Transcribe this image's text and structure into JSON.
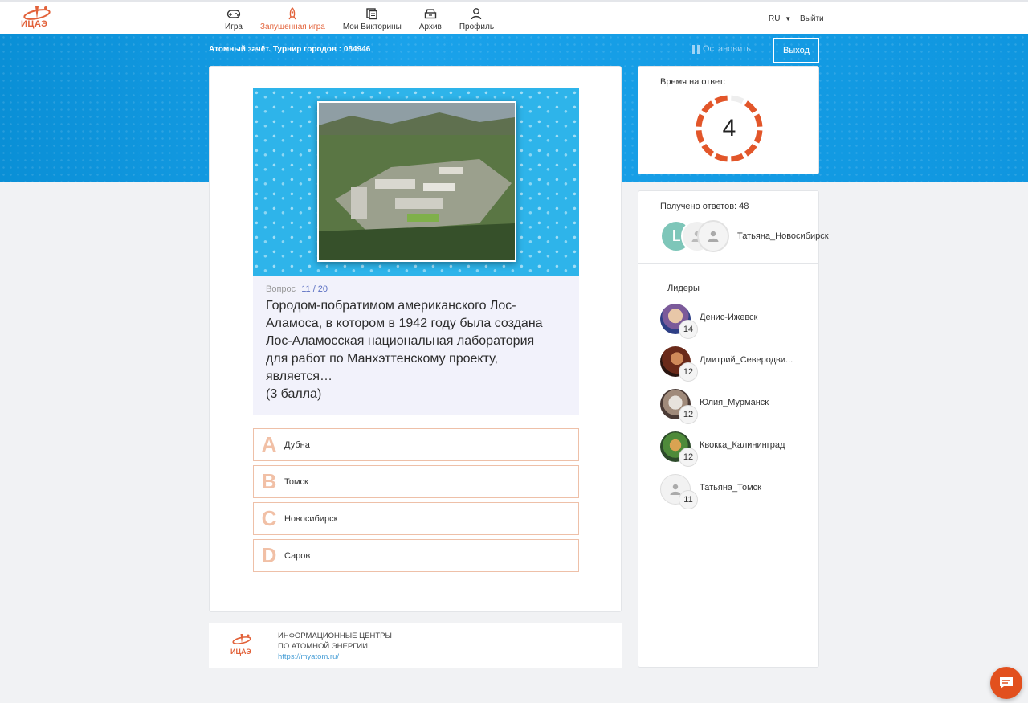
{
  "brand": {
    "logo_text": "ИЦАЭ",
    "accent": "#e2623a"
  },
  "nav": {
    "items": [
      {
        "label": "Игра",
        "icon": "gamepad-icon",
        "active": false
      },
      {
        "label": "Запущенная игра",
        "icon": "rocket-icon",
        "active": true
      },
      {
        "label": "Мои Викторины",
        "icon": "copy-icon",
        "active": false
      },
      {
        "label": "Архив",
        "icon": "archive-icon",
        "active": false
      },
      {
        "label": "Профиль",
        "icon": "user-icon",
        "active": false
      }
    ],
    "lang": "RU",
    "logout": "Выйти"
  },
  "game": {
    "title": "Атомный зачёт. Турнир городов : 084946",
    "stop_label": "Остановить",
    "exit_label": "Выход"
  },
  "question": {
    "number_label": "Вопрос",
    "number": "11 / 20",
    "text_lines": [
      "Городом-побратимом американского Лос-",
      "Аламоса, в котором в 1942 году была создана",
      "Лос-Аламосская национальная лаборатория",
      "для работ по Манхэттенскому проекту,",
      "является…",
      "(3 балла)"
    ],
    "answers": [
      {
        "letter": "A",
        "label": "Дубна"
      },
      {
        "letter": "B",
        "label": "Томск"
      },
      {
        "letter": "C",
        "label": "Новосибирск"
      },
      {
        "letter": "D",
        "label": "Саров"
      }
    ]
  },
  "footer": {
    "logo_text": "ИЦАЭ",
    "org_line1": "ИНФОРМАЦИОННЫЕ ЦЕНТРЫ",
    "org_line2": "ПО АТОМНОЙ ЭНЕРГИИ",
    "link": "https://myatom.ru/"
  },
  "timer": {
    "label": "Время на ответ:",
    "value": "4",
    "segments_total": 12,
    "segments_remaining": 11,
    "color": "#e2562a"
  },
  "responses": {
    "label": "Получено ответов: 48",
    "avatar_letter": "L",
    "last_name": "Татьяна_Новосибирск"
  },
  "leaders": {
    "title": "Лидеры",
    "items": [
      {
        "name": "Денис-Ижевск",
        "score": "14"
      },
      {
        "name": "Дмитрий_Северодви...",
        "score": "12"
      },
      {
        "name": "Юлия_Мурманск",
        "score": "12"
      },
      {
        "name": "Квокка_Калининград",
        "score": "12"
      },
      {
        "name": "Татьяна_Томск",
        "score": "11"
      }
    ]
  }
}
